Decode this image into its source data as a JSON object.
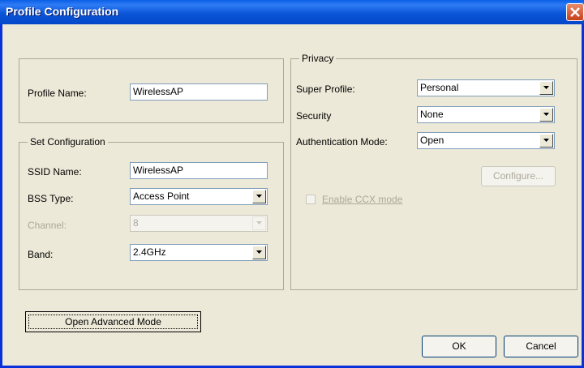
{
  "window": {
    "title": "Profile Configuration"
  },
  "profile": {
    "name_label": "Profile Name:",
    "name_value": "WirelessAP"
  },
  "set_config": {
    "legend": "Set Configuration",
    "ssid_label": "SSID Name:",
    "ssid_value": "WirelessAP",
    "bss_label": "BSS Type:",
    "bss_value": "Access Point",
    "channel_label": "Channel:",
    "channel_value": "8",
    "band_label": "Band:",
    "band_value": "2.4GHz"
  },
  "privacy": {
    "legend": "Privacy",
    "super_profile_label": "Super Profile:",
    "super_profile_value": "Personal",
    "security_label": "Security",
    "security_value": "None",
    "auth_label": "Authentication Mode:",
    "auth_value": "Open",
    "configure_label": "Configure...",
    "ccx_label": "Enable CCX mode"
  },
  "buttons": {
    "advanced": "Open Advanced Mode",
    "ok": "OK",
    "cancel": "Cancel"
  }
}
